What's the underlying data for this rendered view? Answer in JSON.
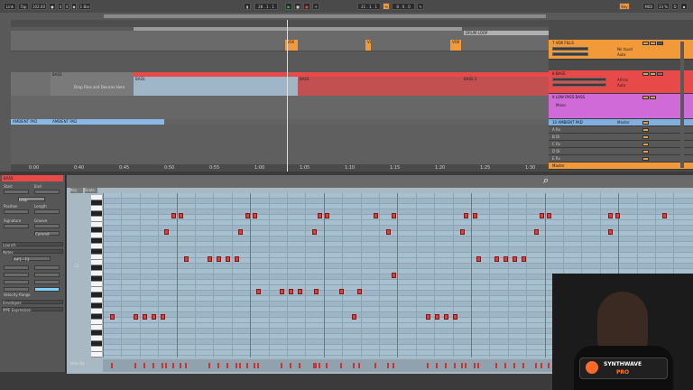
{
  "transport": {
    "link_label": "Link",
    "tap_label": "Tap",
    "tempo": "102.00",
    "sig_num": "4",
    "sig_den": "4",
    "bars_label": "1 Bar",
    "position": "28 . 1 . 1",
    "loop_start": "21 . 1 . 1",
    "loop_len": "8 . 0 . 0",
    "key_label": "Key",
    "midi_label": "MIDI",
    "cpu": "33 %"
  },
  "arrangement": {
    "clip_vox": "VOX",
    "clip_bass": "BASS",
    "clip_bass2": "BASS 2",
    "clip_drum_loop": "DRUM LOOP",
    "drop_hint": "Drop Files and Devices Here",
    "clip_amb1": "AMBIENT PAD",
    "clip_amb2": "AMBIENT PAD",
    "time_labels": [
      "0:00",
      "0:40",
      "0:45",
      "0:50",
      "0:55",
      "1:00",
      "1:05",
      "1:10",
      "1:15",
      "1:20",
      "1:25",
      "1:30"
    ]
  },
  "tracks": [
    {
      "name": "7 VOX FILLS",
      "color": "#f29a3a",
      "num": "7"
    },
    {
      "name": "8 BASS",
      "color": "#e84a4a",
      "num": "8"
    },
    {
      "name": "9 LOW PASS BASS",
      "color": "#d06ad8",
      "num": "9"
    },
    {
      "name": "10 AMBIENT PAD",
      "color": "#7fb0e0",
      "num": "10"
    },
    {
      "name": "A Rv",
      "color": "#888888",
      "num": "A"
    },
    {
      "name": "B Dl",
      "color": "#888888",
      "num": "B"
    },
    {
      "name": "C Rv",
      "color": "#888888",
      "num": "C"
    },
    {
      "name": "D Dl",
      "color": "#888888",
      "num": "D"
    },
    {
      "name": "E Rv",
      "color": "#888888",
      "num": "E"
    },
    {
      "name": "Master",
      "color": "#f29a3a",
      "num": "M"
    }
  ],
  "track_devices": {
    "vox_in": "No Input",
    "vox_mode": "Auto",
    "bass_in": "All Ins",
    "bass_mode": "Auto",
    "lp_in": "Mono",
    "pad_in": "Master"
  },
  "clip_panel": {
    "clip_name": "BASS",
    "signature_label": "Signature",
    "groove_label": "Groove",
    "commit_label": "Commit",
    "start_label": "Start",
    "end_label": "End",
    "loop_label": "Loop",
    "position_label": "Position",
    "length_label": "Length",
    "launch_label": "Launch",
    "notes_label": "Notes",
    "notes_range": "A#1 - F3",
    "velocity_label": "Velocity Range",
    "envelopes_label": "Envelopes",
    "expression_label": "MPE Expression"
  },
  "piano_roll": {
    "key_label": "Key",
    "scale_label": "Scale",
    "c_label": "C2",
    "velocity_label": "Velocity",
    "ruler": [
      "1",
      "1.2",
      "1.3",
      "1.4",
      "2",
      "2.2",
      "2.3",
      "2.4",
      "3",
      "3.2",
      "3.3",
      "3.4",
      "4",
      "4.2",
      "4.3",
      "4.4",
      "5",
      "5.2",
      "5.3",
      "5.4",
      "6",
      "6.2",
      "6.3",
      "6.4",
      "7",
      "7.2",
      "7.3",
      "7.4",
      "8",
      "8.2",
      "8.3",
      "8.4"
    ]
  },
  "webcam": {
    "logo_line1": "SYNTHWAVE",
    "logo_line2": "PRO"
  }
}
